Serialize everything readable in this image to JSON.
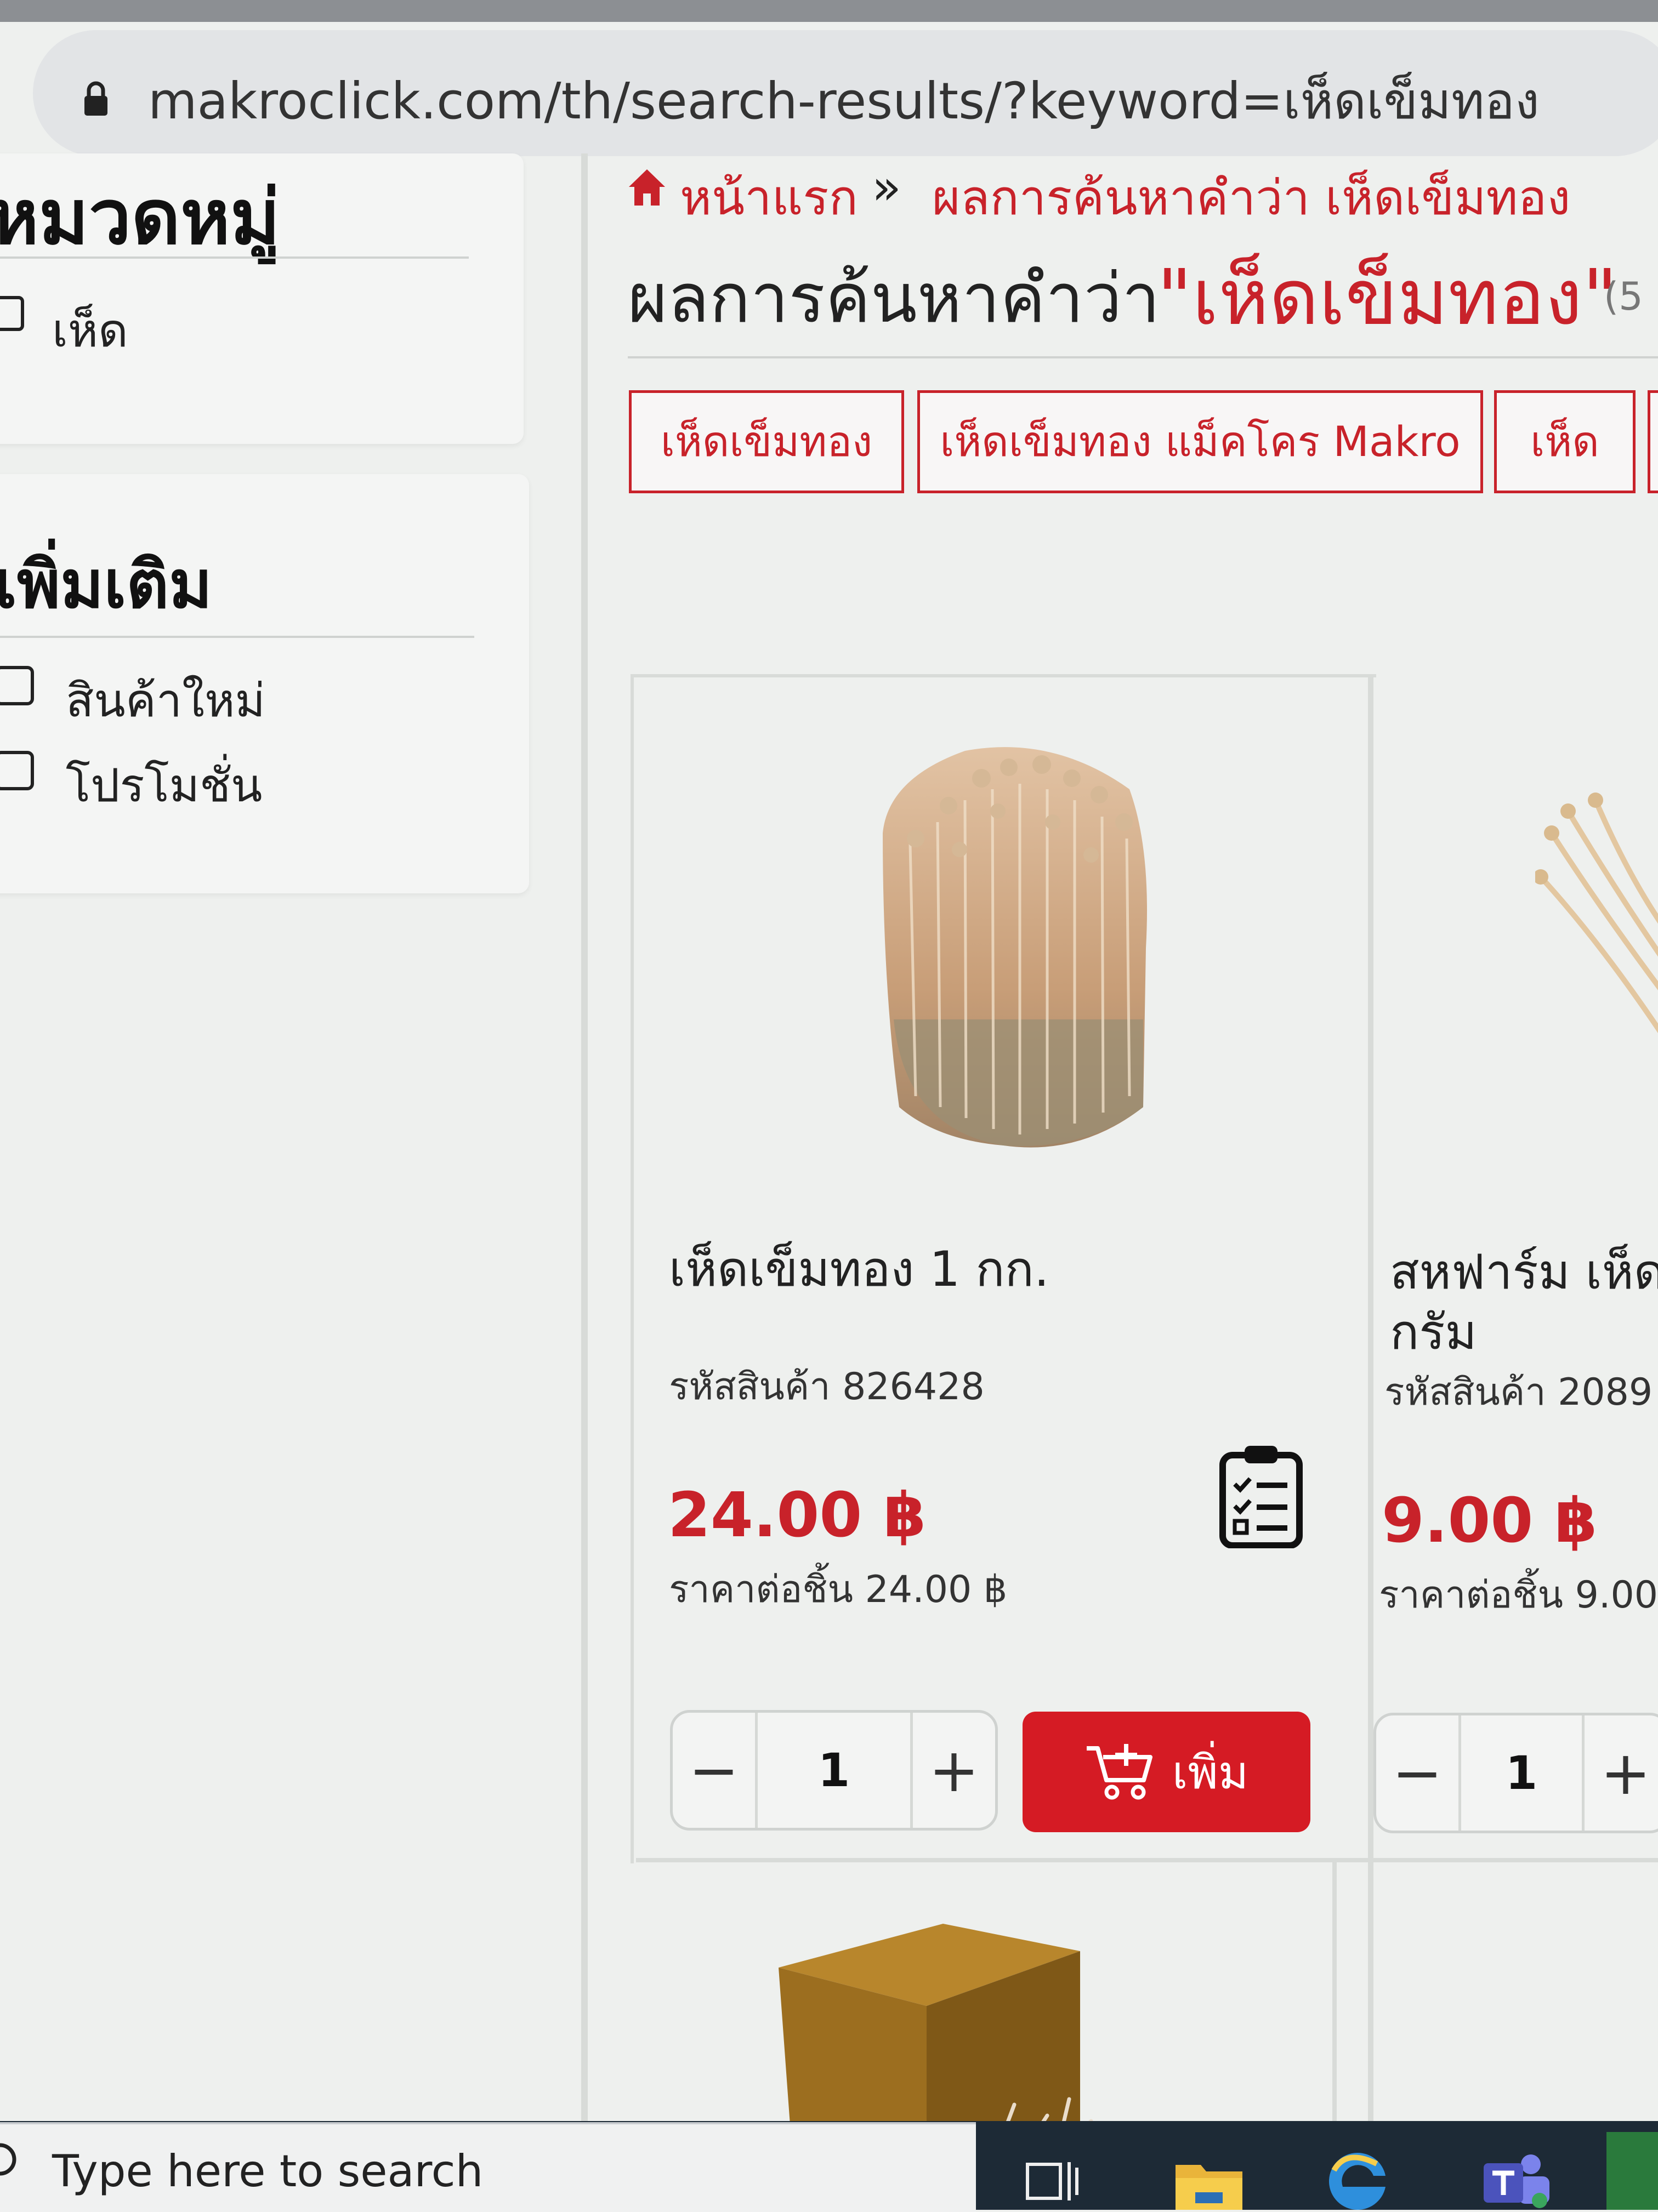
{
  "browser": {
    "url": "makroclick.com/th/search-results/?keyword=เห็ดเข็มทอง"
  },
  "sidebar": {
    "category_title": "หมวดหมู่",
    "category_items": [
      "เห็ด"
    ],
    "more_title": "เพิ่มเติม",
    "more_items": [
      "สินค้าใหม่",
      "โปรโมชั่น"
    ]
  },
  "breadcrumb": {
    "home": "หน้าแรก",
    "separator": "»",
    "current": "ผลการค้นหาคำว่า เห็ดเข็มทอง"
  },
  "search": {
    "title_prefix": "ผลการค้นหาคำว่า",
    "keyword_quoted": "\"เห็ดเข็มทอง\"",
    "count_partial": "(5"
  },
  "tags": [
    "เห็ดเข็มทอง",
    "เห็ดเข็มทอง แม็คโคร Makro",
    "เห็ด"
  ],
  "products": [
    {
      "name": "เห็ดเข็มทอง 1 กก.",
      "code": "รหัสสินค้า 826428",
      "price": "24.00 ฿",
      "unit_price": "ราคาต่อชิ้น 24.00 ฿",
      "quantity": "1",
      "add_label": "เพิ่ม"
    },
    {
      "name_line1": "สหฟาร์ม เห็ด",
      "name_line2": "กรัม",
      "code": "รหัสสินค้า 2089",
      "price": "9.00 ฿",
      "unit_price": "ราคาต่อชิ้น 9.00",
      "quantity": "1"
    }
  ],
  "stepper": {
    "minus": "−",
    "plus": "+"
  },
  "taskbar": {
    "search_placeholder": "Type here to search"
  },
  "colors": {
    "brand_red": "#c8222a",
    "button_red": "#d51b24",
    "taskbar": "#1d2a36"
  },
  "icons": [
    "lock-icon",
    "home-icon",
    "shopping-list-icon",
    "cart-icon",
    "task-view-icon",
    "file-explorer-icon",
    "edge-icon",
    "teams-icon",
    "search-icon"
  ]
}
